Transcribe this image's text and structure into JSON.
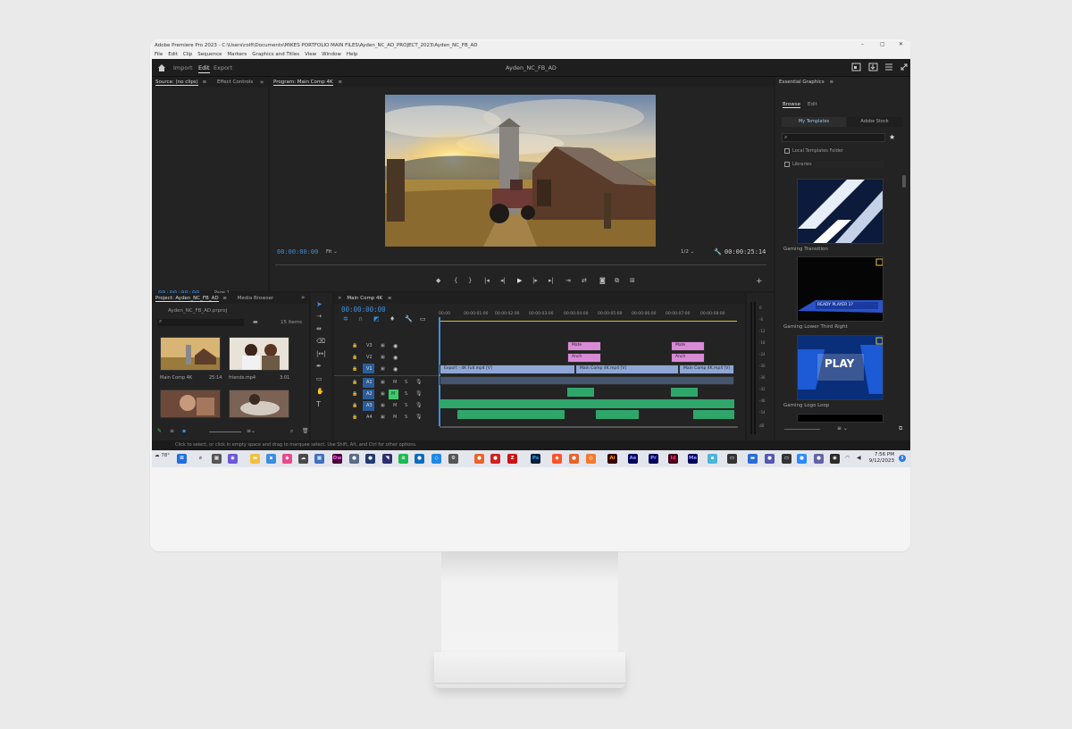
{
  "window": {
    "title": "Adobe Premiere Pro 2023 - C:\\Users\\rolfi\\Documents\\MIKES PORTFOLIO MAIN FILES\\Ayden_NC_AD_PROJECT_2023\\Ayden_NC_FB_AD",
    "minimize": "–",
    "maximize": "▢",
    "close": "✕"
  },
  "menu": [
    "File",
    "Edit",
    "Clip",
    "Sequence",
    "Markers",
    "Graphics and Titles",
    "View",
    "Window",
    "Help"
  ],
  "workspace": {
    "tabs": [
      "Import",
      "Edit",
      "Export"
    ],
    "active": "Edit",
    "project_title": "Ayden_NC_FB_AD"
  },
  "source_panel": {
    "tab": "Source: (no clips)",
    "tab2": "Effect Controls",
    "timecode": "00;00;00;00",
    "page": "Page 1"
  },
  "program_panel": {
    "tab": "Program: Main Comp 4K",
    "timecode": "00:00:00:00",
    "fit": "Fit",
    "resolution": "1/2",
    "duration": "00:00:25:14"
  },
  "project_panel": {
    "tab": "Project: Ayden_NC_FB_AD",
    "tab2": "Media Browser",
    "file": "Ayden_NC_FB_AD.prproj",
    "count": "15 items",
    "items": [
      {
        "name": "Main Comp 4K",
        "dur": "25:14"
      },
      {
        "name": "friends.mp4",
        "dur": "3:01"
      }
    ]
  },
  "timeline": {
    "tab": "Main Comp 4K",
    "timecode": "00:00:00:00",
    "ruler": [
      "00:00",
      "00:00:01:00",
      "00:00:02:00",
      "00:00:03:00",
      "00:00:04:00",
      "00:00:05:00",
      "00:00:06:00",
      "00:00:07:00",
      "00:00:08:00"
    ],
    "tracks": [
      "V3",
      "V2",
      "V1",
      "A1",
      "A2",
      "A3",
      "A4"
    ],
    "clips": {
      "v3_a": "Mate",
      "v3_b": "Mate",
      "v2_a": "Anch",
      "v2_b": "Anch",
      "v1_a": "Export - 4K Full.mp4 [V]",
      "v1_b": "Main Comp 4K.mp4 [V]",
      "v1_c": "Main Comp 4K.mp4 [V]"
    },
    "track_icons": {
      "mute": "M",
      "solo": "S"
    },
    "meter": [
      "0",
      "-6",
      "-12",
      "-18",
      "-24",
      "-30",
      "-36",
      "-42",
      "-48",
      "-54",
      "dB"
    ]
  },
  "essential_graphics": {
    "title": "Essential Graphics",
    "tabs": [
      "Browse",
      "Edit"
    ],
    "subtabs": [
      "My Templates",
      "Adobe Stock"
    ],
    "options": [
      "Local Templates Folder",
      "Libraries"
    ],
    "templates": [
      {
        "name": "Gaming Transition",
        "overlay": ""
      },
      {
        "name": "Gaming Lower Third Right",
        "overlay": "READY PLAYER 1?"
      },
      {
        "name": "Gaming Logo Loop",
        "overlay": "PLAY"
      }
    ]
  },
  "status": "Click to select, or click in empty space and drag to marquee select. Use Shift, Alt, and Ctrl for other options.",
  "taskbar": {
    "weather": "78°",
    "time": "7:56 PM",
    "date": "9/12/2023",
    "apps": [
      "Dw",
      "Ai",
      "Ae",
      "Pr",
      "Id",
      "Me",
      "Ps"
    ]
  }
}
